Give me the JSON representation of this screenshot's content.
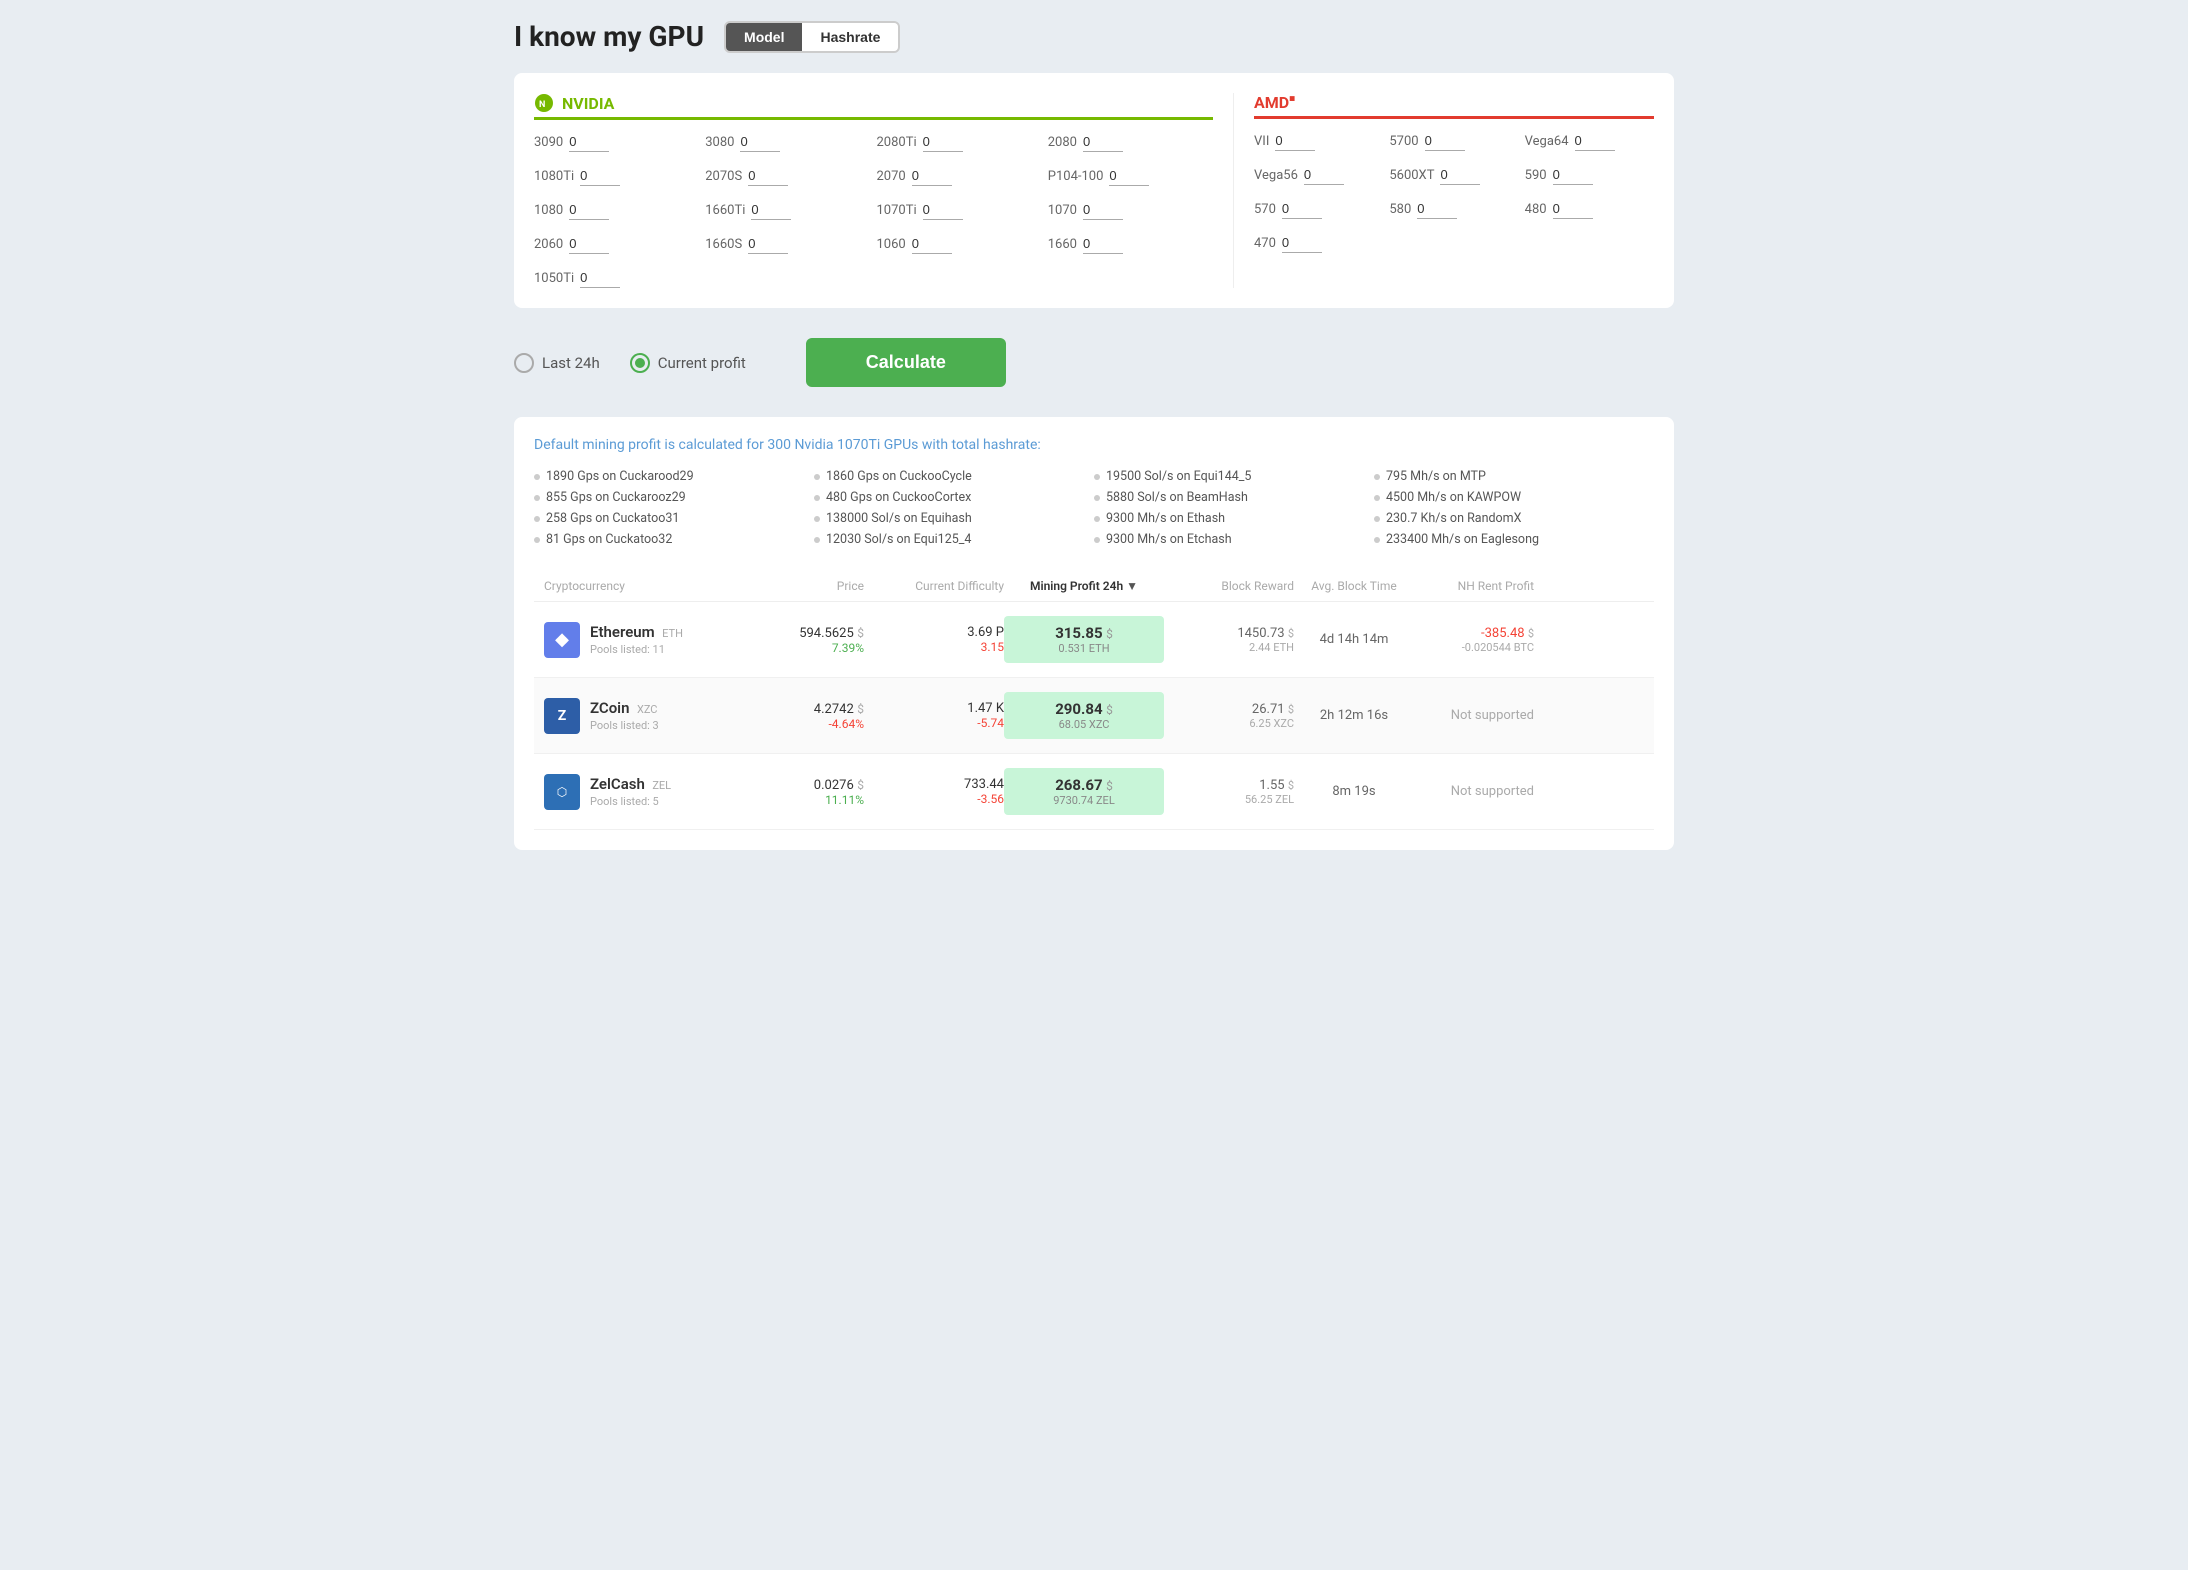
{
  "header": {
    "title": "I know my GPU",
    "toggle": {
      "model_label": "Model",
      "hashrate_label": "Hashrate",
      "active": "hashrate"
    }
  },
  "nvidia": {
    "brand": "NVIDIA",
    "gpus": [
      {
        "label": "3090",
        "value": "0"
      },
      {
        "label": "3080",
        "value": "0"
      },
      {
        "label": "2080Ti",
        "value": "0"
      },
      {
        "label": "2080",
        "value": "0"
      },
      {
        "label": "1080Ti",
        "value": "0"
      },
      {
        "label": "2070S",
        "value": "0"
      },
      {
        "label": "2070",
        "value": "0"
      },
      {
        "label": "P104-100",
        "value": "0"
      },
      {
        "label": "1080",
        "value": "0"
      },
      {
        "label": "1660Ti",
        "value": "0"
      },
      {
        "label": "1070Ti",
        "value": "0"
      },
      {
        "label": "1070",
        "value": "0"
      },
      {
        "label": "2060",
        "value": "0"
      },
      {
        "label": "1660S",
        "value": "0"
      },
      {
        "label": "1060",
        "value": "0"
      },
      {
        "label": "1660",
        "value": "0"
      },
      {
        "label": "1050Ti",
        "value": "0"
      }
    ]
  },
  "amd": {
    "brand": "AMD",
    "gpus": [
      {
        "label": "VII",
        "value": "0"
      },
      {
        "label": "5700",
        "value": "0"
      },
      {
        "label": "Vega64",
        "value": "0"
      },
      {
        "label": "Vega56",
        "value": "0"
      },
      {
        "label": "5600XT",
        "value": "0"
      },
      {
        "label": "590",
        "value": "0"
      },
      {
        "label": "570",
        "value": "0"
      },
      {
        "label": "580",
        "value": "0"
      },
      {
        "label": "480",
        "value": "0"
      },
      {
        "label": "470",
        "value": "0"
      }
    ]
  },
  "controls": {
    "last24h_label": "Last 24h",
    "current_profit_label": "Current profit",
    "calculate_label": "Calculate",
    "selected": "current_profit"
  },
  "default_info": {
    "text": "Default mining profit is calculated for 300 Nvidia 1070Ti GPUs with total hashrate:"
  },
  "hashrates": [
    "1890 Gps on Cuckarood29",
    "1860 Gps on CuckooCycle",
    "19500 Sol/s on Equi144_5",
    "795 Mh/s on MTP",
    "855 Gps on Cuckarooz29",
    "480 Gps on CuckooCortex",
    "5880 Sol/s on BeamHash",
    "4500 Mh/s on KAWPOW",
    "258 Gps on Cuckatoo31",
    "138000 Sol/s on Equihash",
    "9300 Mh/s on Ethash",
    "230.7 Kh/s on RandomX",
    "81 Gps on Cuckatoo32",
    "12030 Sol/s on Equi125_4",
    "9300 Mh/s on Etchash",
    "233400 Mh/s on Eaglesong"
  ],
  "table": {
    "headers": [
      {
        "label": "Cryptocurrency",
        "sort": false
      },
      {
        "label": "Price",
        "sort": false,
        "align": "right"
      },
      {
        "label": "Current Difficulty",
        "sort": false,
        "align": "right"
      },
      {
        "label": "Mining Profit 24h",
        "sort": true,
        "align": "center"
      },
      {
        "label": "Block Reward",
        "sort": false,
        "align": "right"
      },
      {
        "label": "Avg. Block Time",
        "sort": false,
        "align": "center"
      },
      {
        "label": "NH Rent Profit",
        "sort": false,
        "align": "right"
      }
    ],
    "rows": [
      {
        "coin": "Ethereum",
        "ticker": "ETH",
        "pools": "Pools listed: 11",
        "icon_type": "eth",
        "price": "594.5625",
        "price_change": "7.39%",
        "price_change_dir": "pos",
        "difficulty": "3.69 P",
        "difficulty_change": "3.15",
        "difficulty_change_dir": "neg",
        "profit": "315.85",
        "profit_sub": "0.531 ETH",
        "block_reward": "1450.73",
        "block_reward_sub": "2.44 ETH",
        "block_time": "4d 14h 14m",
        "nh_profit": "-385.48",
        "nh_profit_sub": "-0.020544 BTC",
        "nh_dir": "neg"
      },
      {
        "coin": "ZCoin",
        "ticker": "XZC",
        "pools": "Pools listed: 3",
        "icon_type": "zcoin",
        "price": "4.2742",
        "price_change": "-4.64%",
        "price_change_dir": "neg",
        "difficulty": "1.47 K",
        "difficulty_change": "-5.74",
        "difficulty_change_dir": "neg",
        "profit": "290.84",
        "profit_sub": "68.05 XZC",
        "block_reward": "26.71",
        "block_reward_sub": "6.25 XZC",
        "block_time": "2h 12m 16s",
        "nh_profit": "Not supported",
        "nh_profit_sub": "",
        "nh_dir": "na"
      },
      {
        "coin": "ZelCash",
        "ticker": "ZEL",
        "pools": "Pools listed: 5",
        "icon_type": "zel",
        "price": "0.0276",
        "price_change": "11.11%",
        "price_change_dir": "pos",
        "difficulty": "733.44",
        "difficulty_change": "-3.56",
        "difficulty_change_dir": "neg",
        "profit": "268.67",
        "profit_sub": "9730.74 ZEL",
        "block_reward": "1.55",
        "block_reward_sub": "56.25 ZEL",
        "block_time": "8m 19s",
        "nh_profit": "Not supported",
        "nh_profit_sub": "",
        "nh_dir": "na"
      }
    ]
  }
}
